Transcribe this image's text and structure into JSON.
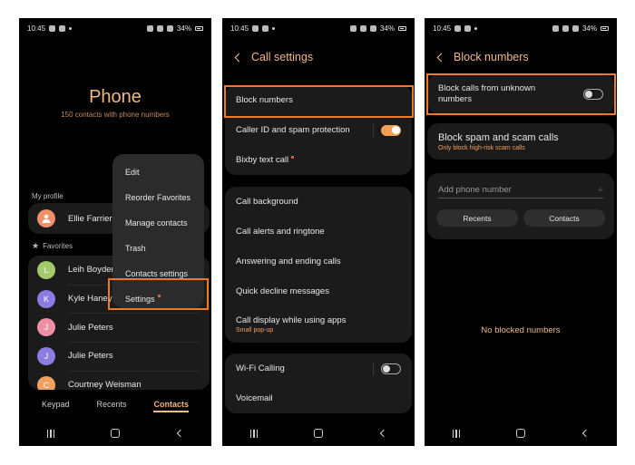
{
  "status": {
    "time": "10:45",
    "battery": "34%"
  },
  "phone1": {
    "title": "Phone",
    "subtitle": "150 contacts with phone numbers",
    "my_profile_label": "My profile",
    "profile": {
      "name": "Ellie Farrier",
      "color": "#f0906a"
    },
    "favorites_label": "Favorites",
    "contacts": [
      {
        "initial": "L",
        "name": "Leih Boyden",
        "color": "#a2c96a"
      },
      {
        "initial": "K",
        "name": "Kyle Haney",
        "color": "#8a7ce0"
      },
      {
        "initial": "J",
        "name": "Julie Peters",
        "color": "#ee8ea2"
      },
      {
        "initial": "J",
        "name": "Julie Peters",
        "color": "#8a7ce0"
      },
      {
        "initial": "C",
        "name": "Courtney Weisman",
        "color": "#f0a060"
      }
    ],
    "menu": {
      "items": [
        "Edit",
        "Reorder Favorites",
        "Manage contacts",
        "Trash",
        "Contacts settings",
        "Settings"
      ]
    },
    "tabs": [
      "Keypad",
      "Recents",
      "Contacts"
    ]
  },
  "phone2": {
    "title": "Call settings",
    "group1": [
      "Block numbers",
      "Caller ID and spam protection",
      "Bixby text call"
    ],
    "group2": [
      "Call background",
      "Call alerts and ringtone",
      "Answering and ending calls",
      "Quick decline messages"
    ],
    "call_display": {
      "title": "Call display while using apps",
      "sub": "Small pop-up"
    },
    "group3": [
      "Wi-Fi Calling",
      "Voicemail"
    ]
  },
  "phone3": {
    "title": "Block numbers",
    "unknown_label": "Block calls from unknown numbers",
    "spam": {
      "title": "Block spam and scam calls",
      "sub": "Only block high-risk scam calls"
    },
    "add_placeholder": "Add phone number",
    "buttons": [
      "Recents",
      "Contacts"
    ],
    "empty": "No blocked numbers"
  },
  "colors": {
    "accent": "#f0b884",
    "highlight": "#ee7a2a",
    "toggle_on": "#f0a050"
  }
}
